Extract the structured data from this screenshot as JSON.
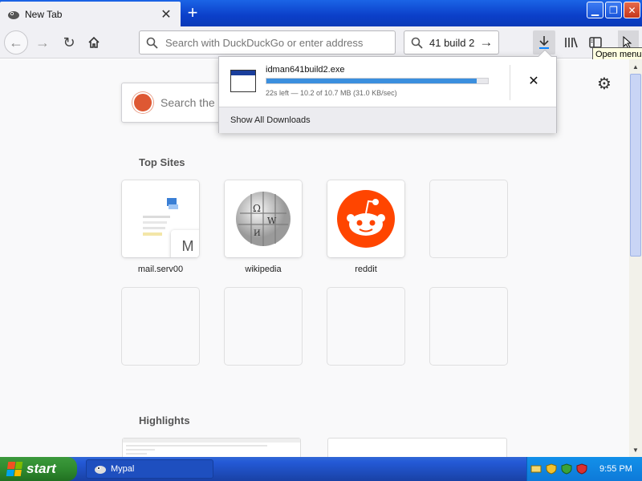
{
  "tab": {
    "title": "New Tab",
    "close_icon": "close-icon"
  },
  "toolbar": {
    "url_placeholder": "Search with DuckDuckGo or enter address",
    "search_text": "41 build 2",
    "menu_tooltip": "Open menu"
  },
  "download": {
    "filename": "idman641build2.exe",
    "status": "22s left — 10.2 of 10.7 MB (31.0 KB/sec)",
    "progress": 0.95,
    "show_all": "Show All Downloads"
  },
  "newtab": {
    "search_placeholder": "Search the",
    "top_sites_title": "Top Sites",
    "highlights_title": "Highlights",
    "sites": [
      {
        "label": "mail.serv00",
        "letter": "M"
      },
      {
        "label": "wikipedia"
      },
      {
        "label": "reddit"
      }
    ]
  },
  "taskbar": {
    "start_label": "start",
    "task_label": "Mypal",
    "clock": "9:55 PM"
  },
  "colors": {
    "titlebar": "#0b3fc9",
    "progress": "#3b8fde",
    "reddit": "#ff4500",
    "duckduckgo": "#de5833"
  }
}
